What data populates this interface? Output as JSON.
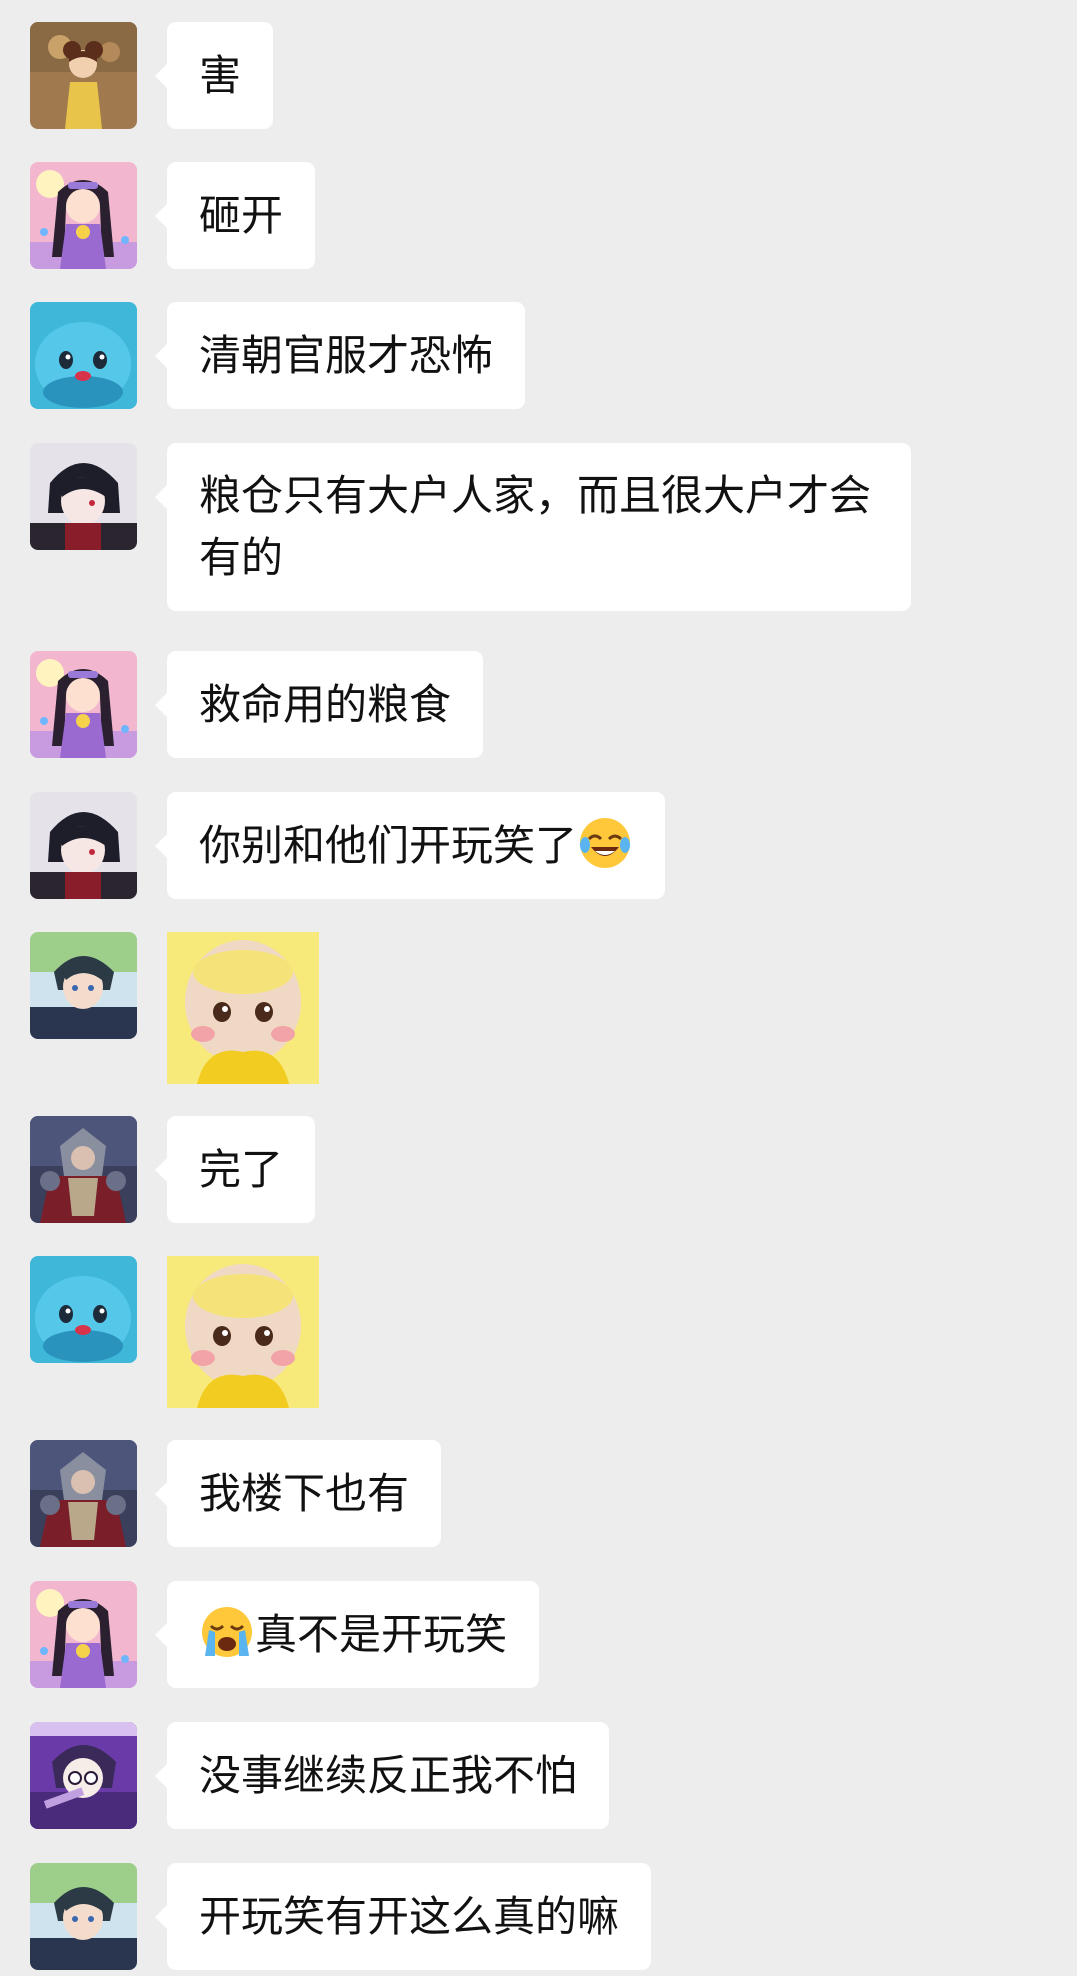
{
  "messages": [
    {
      "type": "text",
      "avatar": "girl-yellow-dress-avatar",
      "text": "害"
    },
    {
      "type": "text",
      "avatar": "pink-anime-girl-avatar",
      "text": "砸开"
    },
    {
      "type": "text",
      "avatar": "blue-creature-avatar",
      "text": "清朝官服才恐怖"
    },
    {
      "type": "text",
      "avatar": "dark-hair-boy-avatar",
      "text": "粮仓只有大户人家，而且很大户才会有的"
    },
    {
      "type": "text",
      "avatar": "pink-anime-girl-avatar",
      "text": "救命用的粮食"
    },
    {
      "type": "text",
      "avatar": "dark-hair-boy-avatar",
      "text": "你别和他们开玩笑了",
      "emoji_after": "tears-of-joy-emoji"
    },
    {
      "type": "sticker",
      "avatar": "anime-boy-avatar",
      "sticker": "yellow-teletubby-sticker"
    },
    {
      "type": "text",
      "avatar": "armored-warrior-avatar",
      "text": "完了"
    },
    {
      "type": "sticker",
      "avatar": "blue-creature-avatar",
      "sticker": "yellow-teletubby-sticker"
    },
    {
      "type": "text",
      "avatar": "armored-warrior-avatar",
      "text": "我楼下也有"
    },
    {
      "type": "text",
      "avatar": "pink-anime-girl-avatar",
      "text": "真不是开玩笑",
      "emoji_before": "loudly-crying-emoji"
    },
    {
      "type": "text",
      "avatar": "purple-anime-avatar",
      "text": "没事继续反正我不怕"
    },
    {
      "type": "text",
      "avatar": "anime-boy-avatar",
      "text": "开玩笑有开这么真的嘛"
    }
  ],
  "colors": {
    "background": "#ededed",
    "bubble": "#ffffff",
    "text": "#111111"
  }
}
